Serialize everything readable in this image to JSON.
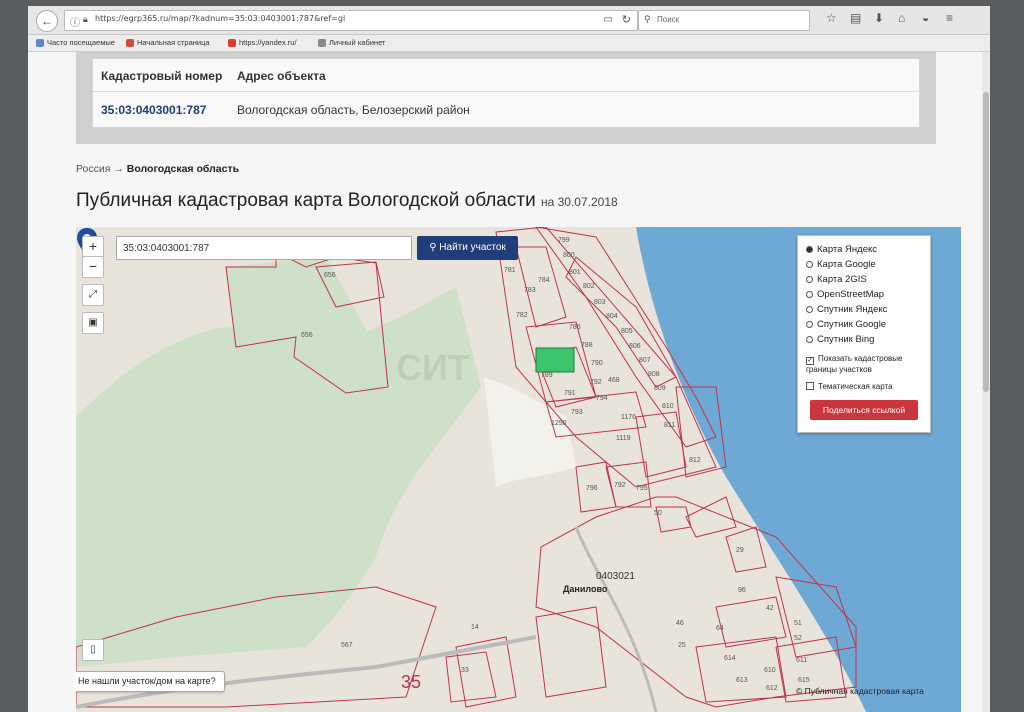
{
  "browser": {
    "url": "https://egrp365.ru/map/?kadnum=35:03:0403001:787&ref=gl",
    "search_placeholder": "Поиск",
    "bookmarks": [
      "Часто посещаемые",
      "Начальная страница",
      "https://yandex.ru/",
      "Личный кабинет"
    ]
  },
  "info_table": {
    "headers": [
      "Кадастровый номер",
      "Адрес объекта"
    ],
    "cadastral_number": "35:03:0403001:787",
    "address": "Вологодская область, Белозерский район"
  },
  "breadcrumb": {
    "root": "Россия",
    "arrow": "→",
    "current": "Вологодская область"
  },
  "heading": {
    "title": "Публичная кадастровая карта Вологодской области",
    "date": "на 30.07.2018"
  },
  "map": {
    "zoom_in": "+",
    "zoom_out": "−",
    "search_value": "35:03:0403001:787",
    "search_button": "Найти участок",
    "layers": [
      {
        "label": "Карта Яндекс",
        "selected": true
      },
      {
        "label": "Карта Google",
        "selected": false
      },
      {
        "label": "Карта 2GIS",
        "selected": false
      },
      {
        "label": "OpenStreetMap",
        "selected": false
      },
      {
        "label": "Спутник Яндекс",
        "selected": false
      },
      {
        "label": "Спутник Google",
        "selected": false
      },
      {
        "label": "Спутник Bing",
        "selected": false
      }
    ],
    "show_borders_label": "Показать кадастровые границы участков",
    "show_borders_checked": true,
    "thematic_label": "Тематическая карта",
    "thematic_checked": false,
    "share_button": "Поделиться ссылкой",
    "not_found": "Не нашли участок/дом на карте?",
    "copyright": "© Публичная кадастровая карта",
    "region_number": "35",
    "village": "Данилово",
    "quarter": "0403021",
    "watermark": "СИТ",
    "parcel_labels": [
      "656",
      "656",
      "567",
      "14",
      "33",
      "799",
      "800",
      "801",
      "802",
      "803",
      "804",
      "805",
      "806",
      "807",
      "808",
      "809",
      "810",
      "811",
      "812",
      "783",
      "784",
      "781",
      "782",
      "786",
      "788",
      "789",
      "790",
      "791",
      "792",
      "468",
      "793",
      "794",
      "1176",
      "1119",
      "1290",
      "796",
      "792",
      "795",
      "50",
      "29",
      "96",
      "42",
      "51",
      "52",
      "46",
      "25",
      "64",
      "614",
      "613",
      "610",
      "612",
      "611",
      "615"
    ]
  },
  "colors": {
    "forest": "#cfe0c8",
    "water": "#6ea9d6",
    "parcel_border": "#c0334a",
    "selected_parcel": "#3cc46a",
    "button_blue": "#1f3e7a",
    "button_red": "#c9363d"
  }
}
